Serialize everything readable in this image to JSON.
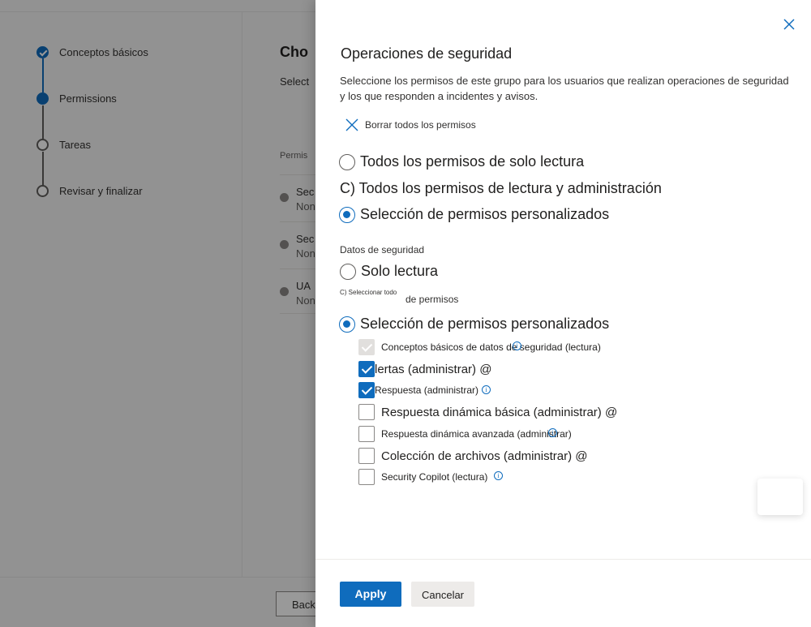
{
  "wizard": {
    "steps": [
      {
        "label": "Conceptos básicos",
        "state": "done"
      },
      {
        "label": "Permissions",
        "state": "current"
      },
      {
        "label": "Tareas",
        "state": "pending"
      },
      {
        "label": "Revisar y finalizar",
        "state": "pending"
      }
    ],
    "title_fragment": "Cho",
    "subtitle_fragment": "Select",
    "column_header_fragment": "Permis",
    "rows": [
      {
        "name": "Sec",
        "sub": "Non"
      },
      {
        "name": "Sec",
        "sub": "Non"
      },
      {
        "name": "UA",
        "sub": "Non"
      }
    ],
    "back_label": "Back"
  },
  "panel": {
    "title": "Operaciones de seguridad",
    "description": "Seleccione los permisos de este grupo para los usuarios que realizan operaciones de seguridad y los que responden a incidentes y avisos.",
    "clear_label": "Borrar todos los permisos",
    "scope_options": [
      {
        "label": "Todos los permisos de solo lectura",
        "selected": false
      },
      {
        "label": "C) Todos los permisos de lectura y administración",
        "selected": false
      },
      {
        "label": "Selección de permisos personalizados",
        "selected": true
      }
    ],
    "section_label": "Datos de seguridad",
    "section_options": {
      "read_only": "Solo lectura",
      "select_all_prefix": "C) Seleccionar todo",
      "select_all_suffix": "de permisos",
      "custom": "Selección de permisos personalizados"
    },
    "permissions": [
      {
        "label": "Conceptos básicos de datos de seguridad (lectura)",
        "state": "disabled-checked"
      },
      {
        "label": "Alertas (administrar) @",
        "state": "checked"
      },
      {
        "label": "Respuesta (administrar)",
        "state": "checked"
      },
      {
        "label": "Respuesta dinámica básica (administrar) @",
        "state": "unchecked"
      },
      {
        "label": "Respuesta dinámica avanzada (administrar)",
        "state": "unchecked"
      },
      {
        "label": "Colección de archivos (administrar) @",
        "state": "unchecked"
      },
      {
        "label": "Security Copilot (lectura)",
        "state": "unchecked"
      }
    ],
    "info_glyph": "i",
    "apply_label": "Apply",
    "cancel_label": "Cancelar"
  },
  "colors": {
    "accent": "#0f6cbd",
    "overlay": "rgba(0,0,0,0.4)"
  }
}
